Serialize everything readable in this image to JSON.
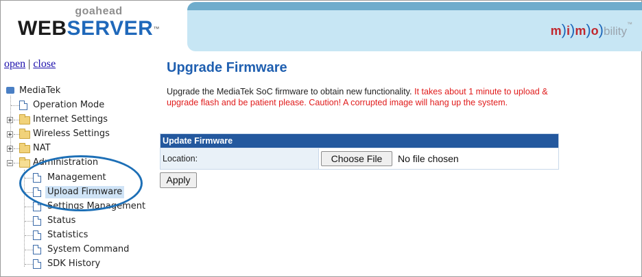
{
  "header": {
    "logo_top": "goahead",
    "logo_web": "WEB",
    "logo_server": "SERVER",
    "logo_tm": "™",
    "brand": {
      "m1": "m",
      "p1": ")",
      "i": "i",
      "p2": ")",
      "m2": "m",
      "p3": ")",
      "o": "o",
      "p4": ")",
      "rest": "bility",
      "tm": "™"
    }
  },
  "nav": {
    "open": "open",
    "separator": "|",
    "close": "close",
    "tree": {
      "root": "MediaTek",
      "items": [
        {
          "label": "Operation Mode",
          "type": "doc"
        },
        {
          "label": "Internet Settings",
          "type": "folder"
        },
        {
          "label": "Wireless Settings",
          "type": "folder"
        },
        {
          "label": "NAT",
          "type": "folder"
        },
        {
          "label": "Administration",
          "type": "folder-open"
        }
      ],
      "admin_children": [
        "Management",
        "Upload Firmware",
        "Settings Management",
        "Status",
        "Statistics",
        "System Command",
        "SDK History"
      ]
    }
  },
  "main": {
    "title": "Upgrade Firmware",
    "desc_normal": "Upgrade the MediaTek SoC firmware to obtain new functionality.",
    "desc_warning": "It takes about 1 minute to upload & upgrade flash and be patient please. Caution! A corrupted image will hang up the system.",
    "table_header": "Update Firmware",
    "location_label": "Location:",
    "choose_file": "Choose File",
    "no_file": "No file chosen",
    "apply": "Apply"
  },
  "colors": {
    "title_blue": "#1f5fb0",
    "header_bar": "#23589e",
    "warning_red": "#e01b1b",
    "highlight_oval": "#1d6fb6",
    "banner": "#c7e6f4"
  }
}
